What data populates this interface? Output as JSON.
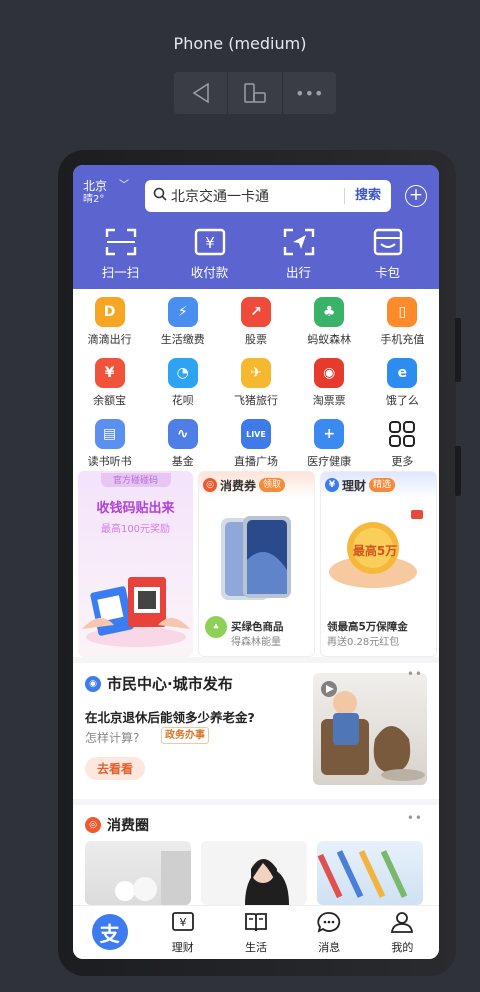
{
  "device": {
    "title": "Phone (medium)",
    "toolbar": {
      "more": "•••"
    }
  },
  "header": {
    "city": "北京",
    "weather": "晴2°",
    "search_text": "北京交通一卡通",
    "search_button": "搜索",
    "plus": "+",
    "actions": [
      {
        "label": "扫一扫",
        "icon": "scan-icon"
      },
      {
        "label": "收付款",
        "icon": "pay-icon"
      },
      {
        "label": "出行",
        "icon": "travel-icon"
      },
      {
        "label": "卡包",
        "icon": "cardpack-icon"
      }
    ]
  },
  "services": [
    {
      "label": "滴滴出行",
      "icon": "didi-icon",
      "color": "#f6a623",
      "glyph": "D"
    },
    {
      "label": "生活缴费",
      "icon": "utility-icon",
      "color": "#4a8ff0",
      "glyph": "⚡"
    },
    {
      "label": "股票",
      "icon": "stock-icon",
      "color": "#f04a3a",
      "glyph": "↗"
    },
    {
      "label": "蚂蚁森林",
      "icon": "forest-icon",
      "color": "#39b36a",
      "glyph": "♣"
    },
    {
      "label": "手机充值",
      "icon": "phone-topup-icon",
      "color": "#ff8a2a",
      "glyph": "▯"
    },
    {
      "label": "余额宝",
      "icon": "yuebao-icon",
      "color": "#f0533a",
      "glyph": "¥"
    },
    {
      "label": "花呗",
      "icon": "huabei-icon",
      "color": "#2ea3f2",
      "glyph": "◔"
    },
    {
      "label": "飞猪旅行",
      "icon": "fliggy-icon",
      "color": "#f5b82e",
      "glyph": "✈"
    },
    {
      "label": "淘票票",
      "icon": "ticket-icon",
      "color": "#e63a2c",
      "glyph": "◉"
    },
    {
      "label": "饿了么",
      "icon": "eleme-icon",
      "color": "#2d8cf0",
      "glyph": "e"
    },
    {
      "label": "读书听书",
      "icon": "books-icon",
      "color": "#5b8ff0",
      "glyph": "▤"
    },
    {
      "label": "基金",
      "icon": "fund-icon",
      "color": "#4f7fe6",
      "glyph": "∿"
    },
    {
      "label": "直播广场",
      "icon": "live-icon",
      "color": "#3f7be8",
      "glyph": "LIVE"
    },
    {
      "label": "医疗健康",
      "icon": "health-icon",
      "color": "#3a8af0",
      "glyph": "+"
    },
    {
      "label": "更多",
      "icon": "more-grid-icon",
      "color": "#ffffff",
      "glyph": ""
    }
  ],
  "promo_cards": [
    {
      "tag": "官方碰碰码",
      "title": "收钱码贴出来",
      "subtitle": "最高100元奖励"
    },
    {
      "head": "消费券",
      "pill": "领取",
      "caption": "买绿色商品",
      "subcaption": "得森林能量"
    },
    {
      "head": "理财",
      "pill": "精选",
      "badge": "最高5万",
      "caption": "领最高5万保障金",
      "subcaption": "再送0.28元红包"
    }
  ],
  "news": {
    "title": "市民中心·城市发布",
    "question": "在北京退休后能领多少养老金?",
    "sub": "怎样计算?",
    "tag": "政务办事",
    "cta": "去看看",
    "more": "••"
  },
  "consumption": {
    "title": "消费圈",
    "more": "••"
  },
  "tabbar": [
    {
      "label": "",
      "icon": "home-alipay-icon",
      "glyph": "支"
    },
    {
      "label": "理财",
      "icon": "finance-icon"
    },
    {
      "label": "生活",
      "icon": "life-icon"
    },
    {
      "label": "消息",
      "icon": "message-icon"
    },
    {
      "label": "我的",
      "icon": "profile-icon"
    }
  ]
}
